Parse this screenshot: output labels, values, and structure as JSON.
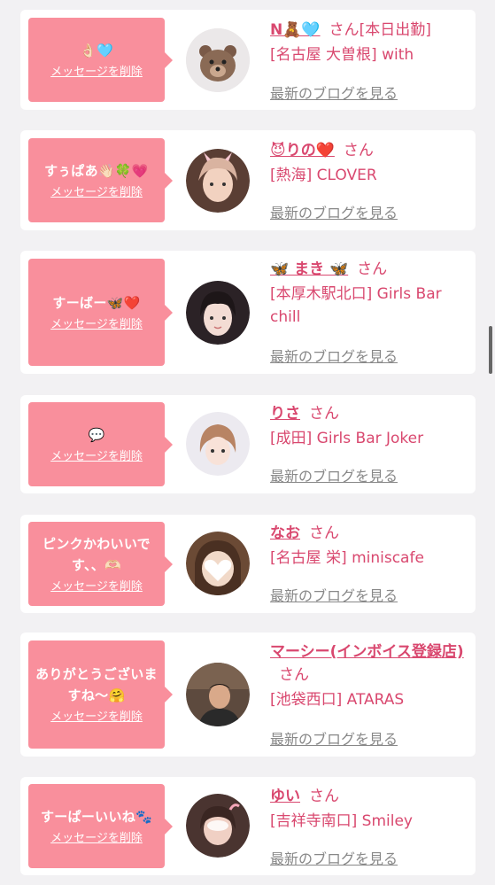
{
  "delete_label": "メッセージを削除",
  "blog_label": "最新のブログを見る",
  "honorific": "さん",
  "cards": [
    {
      "message": "👌🏻🩵",
      "name": "N🧸🩵",
      "status": "[本日出勤]",
      "shop": "[名古屋 大曽根] with",
      "avatar": "teddy-bear-avatar"
    },
    {
      "message": "すぅぱあ👋🏻🍀💗",
      "name": "😈りの❤️",
      "status": "",
      "shop": "[熱海] CLOVER",
      "avatar": "girl-avatar"
    },
    {
      "message": "すーばー🦋❤️",
      "name": "🦋 まき 🦋",
      "status": "",
      "shop": "[本厚木駅北口] Girls Bar chill",
      "avatar": "girl-avatar"
    },
    {
      "message": "💬",
      "name": "りさ",
      "status": "",
      "shop": "[成田] Girls Bar Joker",
      "avatar": "girl-avatar"
    },
    {
      "message": "ピンクかわいいです、、🫶🏻",
      "name": "なお",
      "status": "",
      "shop": "[名古屋 栄] miniscafe",
      "avatar": "heart-face-avatar"
    },
    {
      "message": "ありがとうございますね〜🤗",
      "name": "マーシー(インボイス登録店)",
      "status": "",
      "shop": "[池袋西口] ATARAS",
      "avatar": "man-avatar"
    },
    {
      "message": "すーぱーいいね🐾",
      "name": "ゆい",
      "status": "",
      "shop": "[吉祥寺南口] Smiley",
      "avatar": "girl-avatar"
    }
  ]
}
